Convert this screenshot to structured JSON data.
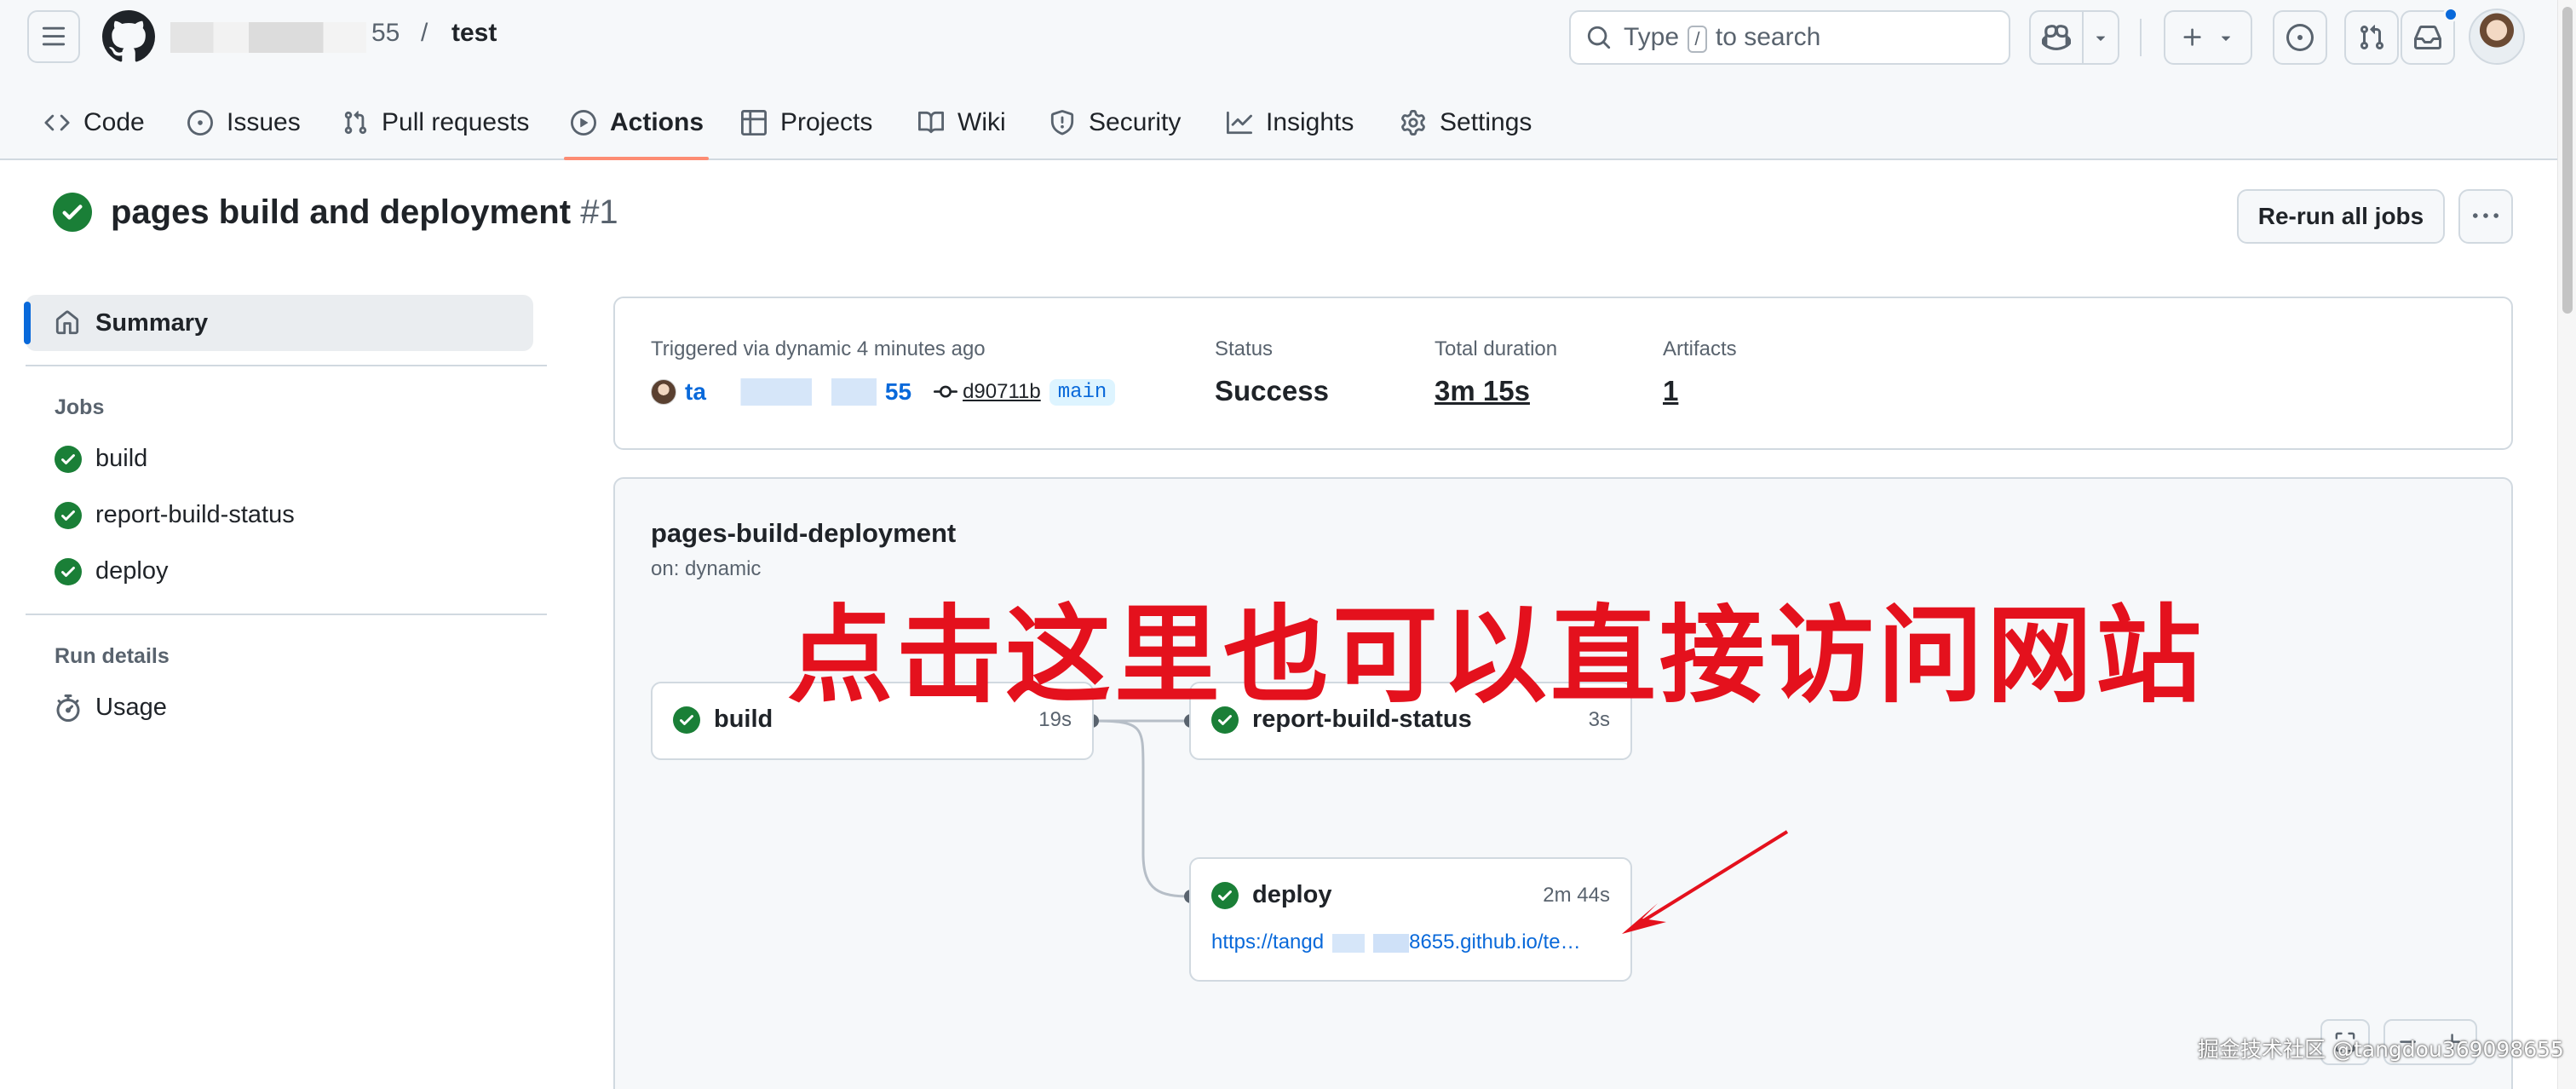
{
  "header": {
    "repo_owner_tail": "55",
    "repo_separator": "/",
    "repo_name": "test",
    "search": {
      "prefix": "Type",
      "key": "/",
      "suffix": "to search"
    },
    "icons": [
      "hamburger-icon",
      "github-logo-icon",
      "search-icon",
      "copilot-icon",
      "plus-icon",
      "issue-opened-icon",
      "git-pull-request-icon",
      "inbox-icon"
    ]
  },
  "tabs": [
    {
      "label": "Code",
      "icon": "code-icon"
    },
    {
      "label": "Issues",
      "icon": "issue-opened-icon"
    },
    {
      "label": "Pull requests",
      "icon": "git-pull-request-icon"
    },
    {
      "label": "Actions",
      "icon": "play-icon",
      "selected": true
    },
    {
      "label": "Projects",
      "icon": "table-icon"
    },
    {
      "label": "Wiki",
      "icon": "book-icon"
    },
    {
      "label": "Security",
      "icon": "shield-icon"
    },
    {
      "label": "Insights",
      "icon": "graph-icon"
    },
    {
      "label": "Settings",
      "icon": "gear-icon"
    }
  ],
  "run": {
    "title": "pages build and deployment",
    "number": "#1",
    "rerun_label": "Re-run all jobs",
    "more_label": "···"
  },
  "sidebar": {
    "summary_label": "Summary",
    "jobs_heading": "Jobs",
    "jobs": [
      "build",
      "report-build-status",
      "deploy"
    ],
    "run_details_heading": "Run details",
    "usage_label": "Usage"
  },
  "summary": {
    "triggered_text": "Triggered via dynamic 4 minutes ago",
    "actor_prefix": "ta",
    "actor_suffix": "55",
    "commit_sha": "d90711b",
    "branch": "main",
    "status_label": "Status",
    "status_value": "Success",
    "duration_label": "Total duration",
    "duration_value": "3m 15s",
    "artifacts_label": "Artifacts",
    "artifacts_value": "1"
  },
  "workflow": {
    "name": "pages-build-deployment",
    "trigger": "on: dynamic",
    "jobs": [
      {
        "name": "build",
        "duration": "19s"
      },
      {
        "name": "report-build-status",
        "duration": "3s"
      },
      {
        "name": "deploy",
        "duration": "2m 44s",
        "url_prefix": "https://tangd",
        "url_suffix": "8655.github.io/te…"
      }
    ]
  },
  "annotation": {
    "text": "点击这里也可以直接访问网站",
    "color": "#e4111d"
  },
  "watermark": "掘金技术社区 @tangdou369098655",
  "colors": {
    "success": "#1a7f37",
    "accent": "#0969da",
    "selected_tab_underline": "#fd8c73"
  }
}
